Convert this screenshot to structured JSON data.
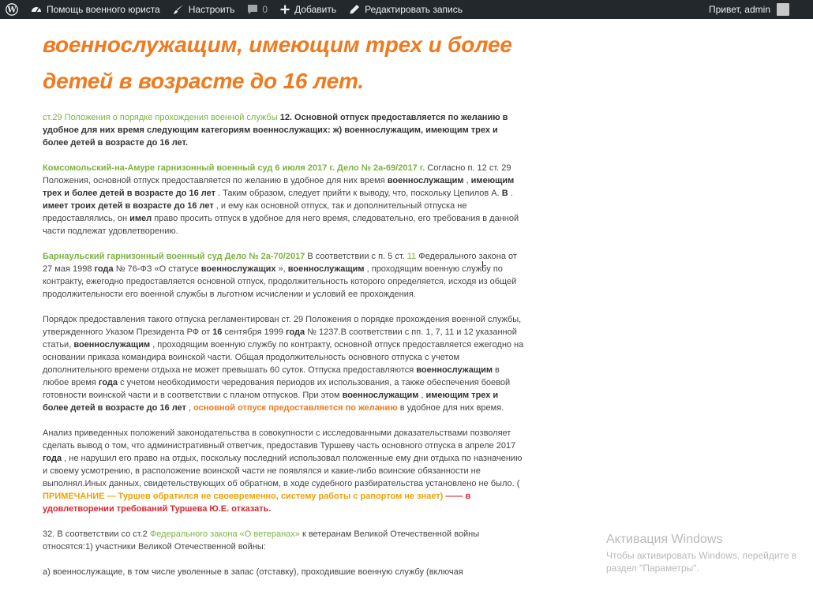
{
  "adminbar": {
    "site_name": "Помощь военного юриста",
    "customize": "Настроить",
    "comments_count": "0",
    "new": "Добавить",
    "edit": "Редактировать запись",
    "howdy": "Привет, admin",
    "icons": [
      "wordpress-icon",
      "dashboard-icon",
      "brush-icon",
      "comment-icon",
      "plus-icon",
      "pencil-icon"
    ]
  },
  "article": {
    "title": "военнослужащим, имеющим трех и более детей в возрасте до 16 лет.",
    "p1": {
      "link": "ст.29 Положения о порядке прохождения военной службы",
      "bold": " 12. Основной отпуск предоставляется по желанию в удобное для них время следующим категориям военнослужащих: ж) военнослужащим, имеющим трех и более детей в возрасте до 16 лет."
    },
    "p2": {
      "link": "Комсомольский-на-Амуре гарнизонный военный суд 6 июля 2017 г. Дело № 2а-69/2017 г.",
      "t1": " Согласно п. 12 ст. 29 Положения, основной отпуск предоставляется по желанию в удобное для них время ",
      "b1": "военнослужащим",
      "t2": " , ",
      "b2": "имеющим трех и более детей в возрасте до 16 лет",
      "t3": " . Таким образом, следует прийти к выводу, что, поскольку Цепилов А. ",
      "b3": "В",
      "t4": " . ",
      "b4": "имеет троих детей в возрасте до 16 лет",
      "t5": " , и ему как основной отпуск, так и дополнительный отпуска не предоставлялись, он ",
      "b5": "имел",
      "t6": " право просить отпуск в удобное для него время, следовательно, его требования в данной части подлежат удовлетворению."
    },
    "p3": {
      "link": "Барнаульский гарнизонный военный суд Дело № 2а-70/2017",
      "t1": " В соответствии с п. 5 ст. ",
      "g1": "11",
      "t2": " Федерального закона от 27 мая 1998 ",
      "b1": "года",
      "t3": " № 76-ФЗ «О статусе ",
      "b2": "военнослужащих",
      "t4": " », ",
      "b3": "военнослужащим",
      "t5": " , проходящим военную службу по контракту, ежегодно предоставляется основной отпуск, продолжительность которого определяется, исходя из общей продолжительности его военной службы в льготном исчислении и условий ее прохождения."
    },
    "p4": {
      "t1": "Порядок предоставления такого отпуска регламентирован ст. 29 Положения о порядке прохождения военной службы, утвержденного Указом Президента РФ от ",
      "b1": "16",
      "t2": " сентября 1999 ",
      "b2": "года",
      "t3": " № 1237.В соответствии с пп. 1, 7, 11 и 12 указанной статьи, ",
      "b3": "военнослужащим",
      "t4": " , проходящим военную службу по контракту, основной отпуск предоставляется ежегодно на основании приказа командира воинской части. Общая продолжительность основного отпуска с учетом дополнительного времени отдыха не может превышать 60 суток. Отпуска предоставляются ",
      "b4": "военнослужащим",
      "t5": " в любое время ",
      "b5": "года",
      "t6": " с учетом необходимости чередования периодов их использования, а также обеспечения боевой готовности воинской части и в соответствии с планом отпусков. При этом ",
      "b6": "военнослужащим",
      "t7": " , ",
      "b7": "имеющим трех и более детей в возрасте до 16 лет",
      "t8": " , ",
      "o1": "основной отпуск предоставляется по желанию",
      "t9": " в удобное для них время."
    },
    "p5": {
      "t1": "Анализ приведенных положений законодательства в совокупности с исследованными доказательствами позволяет сделать вывод о том, что административный ответчик, предоставив Туршеву часть основного отпуска в апреле 2017 ",
      "b1": "года",
      "t2": " , не нарушил его право на отдых, поскольку последний использовал положенные ему дни отдыха по назначению и своему усмотрению, в расположение воинской части не появлялся и какие-либо воинские обязанности не выполнял.Иных данных, свидетельствующих об обратном, в ходе судебного разбирательства установлено не было. ( ",
      "y1": "ПРИМЕЧАНИЕ — Туршев обратился не своевременно, систему работы с рапортом не знает)",
      "r1": " —— в удовлетворении требований Туршева Ю.Е. отказать."
    },
    "p6": {
      "t1": "32. В соответствии со ст.2 ",
      "link": "Федерального закона «О ветеранах»",
      "t2": " к ветеранам Великой Отечественной войны относятся:1) участники Великой Отечественной войны:"
    },
    "p7": {
      "t1": "а) военнослужащие, в том числе уволенные в запас (отставку), проходившие военную службу (включая"
    }
  },
  "watermark": {
    "title": "Активация Windows",
    "line1": "Чтобы активировать Windows, перейдите в",
    "line2": "раздел \"Параметры\"."
  },
  "colors": {
    "adminbar_bg": "#23282d",
    "title": "#f07a1e",
    "link_green": "#7cb342",
    "highlight_orange": "#f07a1e",
    "note_yellow": "#f0a100",
    "verdict_red": "#d9272e"
  }
}
